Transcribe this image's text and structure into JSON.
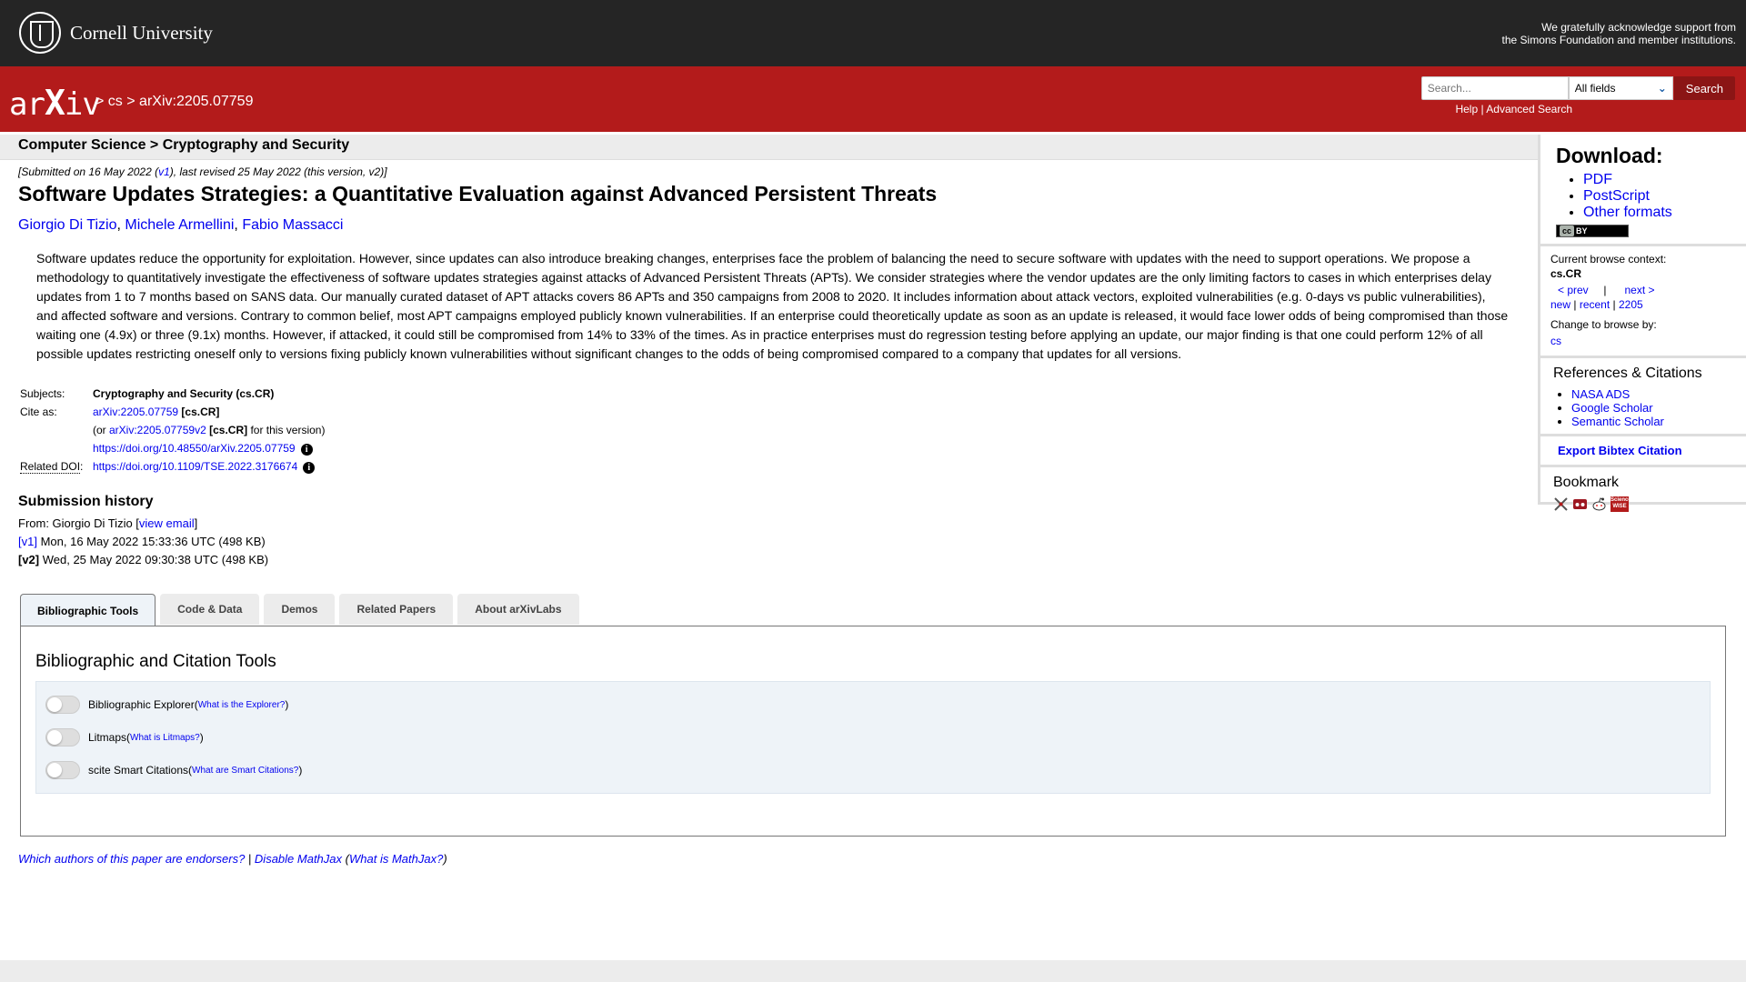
{
  "topbar": {
    "org_name": "Cornell University",
    "ack_line1": "We gratefully acknowledge support from",
    "ack_line2": "the Simons Foundation and member institutions."
  },
  "header": {
    "logo_text_a": "ar",
    "logo_text_x": "X",
    "logo_text_b": "iv",
    "crumb_sep1": ">",
    "crumb_cs": "cs",
    "crumb_sep2": ">",
    "crumb_id": "arXiv:2205.07759",
    "search_placeholder": "Search...",
    "search_field": "All fields",
    "search_button": "Search",
    "help_link": "Help",
    "help_sep": "|",
    "advanced_link": "Advanced Search"
  },
  "subheader": {
    "text": "Computer Science > Cryptography and Security"
  },
  "paper": {
    "date_pre": "[Submitted on 16 May 2022 (",
    "date_v1": "v1",
    "date_post": "), last revised 25 May 2022 (this version, v2)]",
    "title": "Software Updates Strategies: a Quantitative Evaluation against Advanced Persistent Threats",
    "authors": [
      "Giorgio Di Tizio",
      "Michele Armellini",
      "Fabio Massacci"
    ],
    "author_sep": ", ",
    "abstract": "Software updates reduce the opportunity for exploitation. However, since updates can also introduce breaking changes, enterprises face the problem of balancing the need to secure software with updates with the need to support operations. We propose a methodology to quantitatively investigate the effectiveness of software updates strategies against attacks of Advanced Persistent Threats (APTs). We consider strategies where the vendor updates are the only limiting factors to cases in which enterprises delay updates from 1 to 7 months based on SANS data. Our manually curated dataset of APT attacks covers 86 APTs and 350 campaigns from 2008 to 2020. It includes information about attack vectors, exploited vulnerabilities (e.g. 0-days vs public vulnerabilities), and affected software and versions. Contrary to common belief, most APT campaigns employed publicly known vulnerabilities. If an enterprise could theoretically update as soon as an update is released, it would face lower odds of being compromised than those waiting one (4.9x) or three (9.1x) months. However, if attacked, it could still be compromised from 14% to 33% of the times. As in practice enterprises must do regression testing before applying an update, our major finding is that one could perform 12% of all possible updates restricting oneself only to versions fixing publicly known vulnerabilities without significant changes to the odds of being compromised compared to a company that updates for all versions."
  },
  "meta": {
    "subjects_label": "Subjects:",
    "subjects_value": "Cryptography and Security (cs.CR)",
    "cite_label": "Cite as:",
    "cite_id": "arXiv:2205.07759",
    "cite_cat": "[cs.CR]",
    "cite_or": "(or ",
    "cite_v2": "arXiv:2205.07759v2",
    "cite_v2_cat": "[cs.CR]",
    "cite_this": " for this version)",
    "doi_arxiv": "https://doi.org/10.48550/arXiv.2205.07759",
    "related_label": "Related DOI",
    "related_colon": ":",
    "related_doi": "https://doi.org/10.1109/TSE.2022.3176674",
    "info_glyph": "i"
  },
  "history": {
    "title": "Submission history",
    "from_pre": "From: Giorgio Di Tizio [",
    "view_email": "view email",
    "from_post": "]",
    "v1_label": "[v1]",
    "v1_text": " Mon, 16 May 2022 15:33:36 UTC (498 KB)",
    "v2_label": "[v2]",
    "v2_text": " Wed, 25 May 2022 09:30:38 UTC (498 KB)"
  },
  "sidebar": {
    "download_title": "Download:",
    "download_links": [
      "PDF",
      "PostScript",
      "Other formats"
    ],
    "cc_left": "cc",
    "cc_right": "BY",
    "context_label": "Current browse context:",
    "context_value": "cs.CR",
    "prev": "< prev",
    "nav_sep": "|",
    "next": "next >",
    "new": "new",
    "recent": "recent",
    "month": "2205",
    "sep": "|",
    "change_label": "Change to browse by:",
    "change_value": "cs",
    "refs_title": "References & Citations",
    "refs": [
      "NASA ADS",
      "Google Scholar",
      "Semantic Scholar"
    ],
    "bibtex": "Export Bibtex Citation",
    "bookmark_title": "Bookmark",
    "sciencewise_text": "Science WISE"
  },
  "tabs": {
    "items": [
      "Bibliographic Tools",
      "Code & Data",
      "Demos",
      "Related Papers",
      "About arXivLabs"
    ]
  },
  "panel": {
    "title": "Bibliographic and Citation Tools",
    "tools": [
      {
        "name": "Bibliographic Explorer",
        "open": " (",
        "link": "What is the Explorer?",
        "close": ")"
      },
      {
        "name": "Litmaps",
        "open": " (",
        "link": "What is Litmaps?",
        "close": ")"
      },
      {
        "name": "scite Smart Citations",
        "open": " (",
        "link": "What are Smart Citations?",
        "close": ")"
      }
    ]
  },
  "endorse": {
    "endorsers": "Which authors of this paper are endorsers?",
    "sep": " | ",
    "mathjax": "Disable MathJax",
    "open": " (",
    "what": "What is MathJax?",
    "close": ")"
  },
  "colors": {
    "arxiv_red": "#b31b1b",
    "top_black": "#252525",
    "link_blue": "#0000ee"
  }
}
